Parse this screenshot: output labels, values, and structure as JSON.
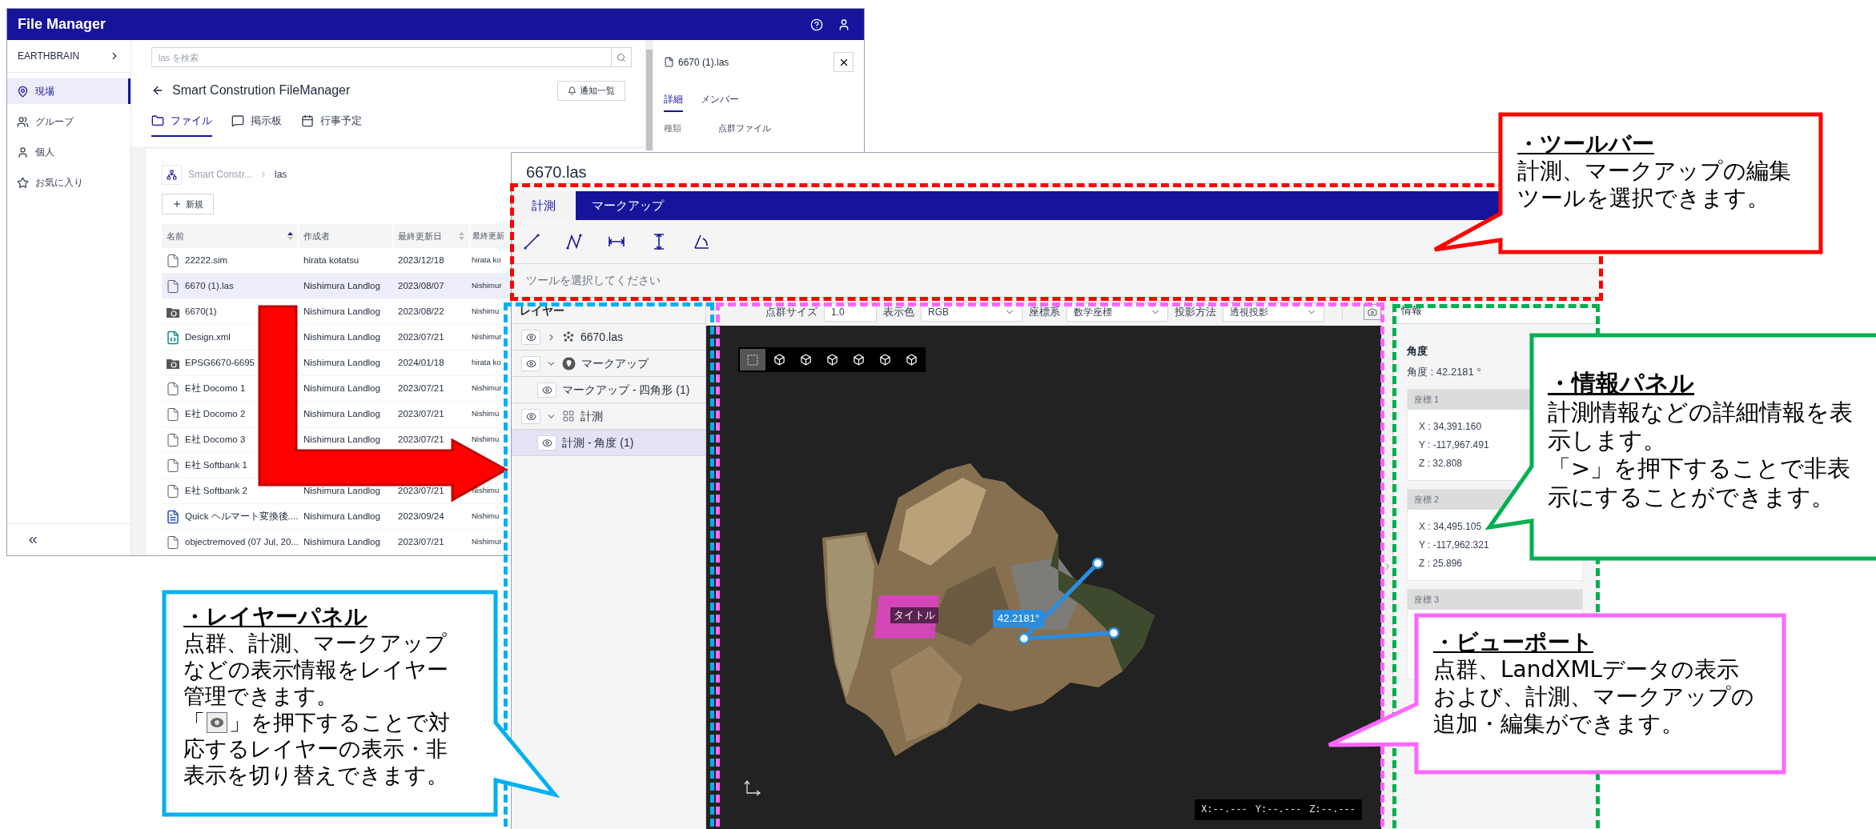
{
  "file_manager": {
    "title": "File Manager",
    "sidebar": {
      "org": "EARTHBRAIN",
      "items": [
        {
          "label": "現場",
          "kind": "site",
          "selected": true
        },
        {
          "label": "グループ",
          "kind": "group",
          "selected": false
        },
        {
          "label": "個人",
          "kind": "person",
          "selected": false
        },
        {
          "label": "お気に入り",
          "kind": "favorite",
          "selected": false
        }
      ]
    },
    "search": {
      "placeholder": "las を検索"
    },
    "page_title": "Smart Constrution FileManager",
    "notify_button": "通知一覧",
    "tabs": [
      {
        "label": "ファイル",
        "kind": "files",
        "selected": true
      },
      {
        "label": "掲示板",
        "kind": "board",
        "selected": false
      },
      {
        "label": "行事予定",
        "kind": "calendar",
        "selected": false
      }
    ],
    "breadcrumb": [
      "Smart Constr...",
      "las"
    ],
    "new_button": "新規",
    "table": {
      "columns": [
        "名前",
        "作成者",
        "最終更新日",
        "最終更新"
      ],
      "rows": [
        {
          "kind": "file",
          "selected": false,
          "cells": [
            "22222.sim",
            "hirata kotatsu",
            "2023/12/18",
            "hirata ko"
          ]
        },
        {
          "kind": "file",
          "selected": true,
          "cells": [
            "6670 (1).las",
            "Nishimura Landlog",
            "2023/08/07",
            "Nishimur"
          ]
        },
        {
          "kind": "folder",
          "selected": false,
          "cells": [
            "6670(1)",
            "Nishimura Landlog",
            "2023/08/22",
            "Nishimu"
          ]
        },
        {
          "kind": "xml",
          "selected": false,
          "cells": [
            "Design.xml",
            "Nishimura Landlog",
            "2023/07/21",
            "Nishimur"
          ]
        },
        {
          "kind": "folder",
          "selected": false,
          "cells": [
            "EPSG6670-6695",
            "Nishimura Landlog",
            "2024/01/18",
            "hirata ko"
          ]
        },
        {
          "kind": "file",
          "selected": false,
          "cells": [
            "E社 Docomo 1",
            "Nishimura Landlog",
            "2023/07/21",
            "Nishimur"
          ]
        },
        {
          "kind": "file",
          "selected": false,
          "cells": [
            "E社 Docomo 2",
            "Nishimura Landlog",
            "2023/07/21",
            "Nishimu"
          ]
        },
        {
          "kind": "file",
          "selected": false,
          "cells": [
            "E社 Docomo 3",
            "Nishimura Landlog",
            "2023/07/21",
            "Nishimu"
          ]
        },
        {
          "kind": "file",
          "selected": false,
          "cells": [
            "E社 Softbank 1"
          ]
        },
        {
          "kind": "file",
          "selected": false,
          "cells": [
            "E社 Softbank 2",
            "Nishimura Landlog",
            "2023/07/21",
            "Nishimu"
          ]
        },
        {
          "kind": "txt",
          "selected": false,
          "cells": [
            "Quick ヘルマート変換後....",
            "Nishimura Landlog",
            "2023/09/24",
            "Nishimu"
          ]
        },
        {
          "kind": "file",
          "selected": false,
          "cells": [
            "objectremoved (07 Jul, 20...",
            "Nishimura Landlog",
            "2023/07/21",
            "Nishimur"
          ]
        }
      ]
    },
    "detail_panel": {
      "title": "6670 (1).las",
      "tabs": [
        {
          "label": "詳細",
          "selected": true
        },
        {
          "label": "メンバー",
          "selected": false
        }
      ],
      "fields": [
        {
          "label": "種類",
          "value": "点群ファイル"
        }
      ]
    }
  },
  "viewer": {
    "title": "6670.las",
    "tabs": [
      {
        "label": "計測",
        "selected": true
      },
      {
        "label": "マークアップ",
        "selected": false
      }
    ],
    "tools": [
      {
        "kind": "line"
      },
      {
        "kind": "polyline"
      },
      {
        "kind": "horizontal"
      },
      {
        "kind": "vertical"
      },
      {
        "kind": "angle"
      }
    ],
    "hint": "ツールを選択してください",
    "layers": {
      "title": "レイヤー",
      "items": [
        {
          "label": "6670.las",
          "kind": "pointcloud",
          "visible": true,
          "expanded": false,
          "selected": false
        },
        {
          "label": "マークアップ",
          "kind": "markup",
          "visible": true,
          "expanded": true,
          "selected": false,
          "children": [
            {
              "label": "マークアップ - 四角形 (1)",
              "visible": true,
              "selected": false
            }
          ]
        },
        {
          "label": "計測",
          "kind": "measure",
          "visible": true,
          "expanded": true,
          "selected": false,
          "children": [
            {
              "label": "計測 - 角度 (1)",
              "visible": true,
              "selected": true
            }
          ]
        }
      ]
    },
    "viewport": {
      "controls": [
        {
          "label": "点群サイズ",
          "kind": "input",
          "value": "1.0"
        },
        {
          "label": "表示色",
          "kind": "select",
          "value": "RGB"
        },
        {
          "label": "座標系",
          "kind": "select",
          "value": "数学座標"
        },
        {
          "label": "投影方法",
          "kind": "select",
          "value": "透視投影"
        }
      ],
      "view_buttons": [
        {
          "selected": true
        },
        {
          "selected": false
        },
        {
          "selected": false
        },
        {
          "selected": false
        },
        {
          "selected": false
        },
        {
          "selected": false
        },
        {
          "selected": false
        }
      ],
      "markup_label": "タイトル",
      "angle_label": "42.2181°",
      "coordinates": [
        "X:--.---",
        "Y:--.---",
        "Z:--.---"
      ]
    },
    "info": {
      "title": "情報",
      "heading": "角度",
      "angle": "角度 : 42.2181 °",
      "points": [
        {
          "title": "座標 1",
          "lines": [
            "X : 34,391.160",
            "Y : -117,967.491",
            "Z : 32.808"
          ]
        },
        {
          "title": "座標 2",
          "lines": [
            "X : 34,495.105",
            "Y : -117,962.321",
            "Z : 25.896"
          ]
        },
        {
          "title": "座標 3"
        }
      ]
    }
  },
  "callouts": [
    {
      "kind": "toolbar",
      "color": "#ff0000",
      "title": "・ツールバー",
      "lines": [
        [
          {
            "kind": "text",
            "text": "計測、マークアップの編集"
          }
        ],
        [
          {
            "kind": "text",
            "text": "ツールを選択できます。"
          }
        ]
      ]
    },
    {
      "kind": "info",
      "color": "#00b050",
      "title": "・情報パネル",
      "lines": [
        [
          {
            "kind": "text",
            "text": "計測情報などの詳細情報を表"
          }
        ],
        [
          {
            "kind": "text",
            "text": "示します。"
          }
        ],
        [
          {
            "kind": "text",
            "text": "「>」を押下することで非表"
          }
        ],
        [
          {
            "kind": "text",
            "text": "示にすることができます。"
          }
        ]
      ]
    },
    {
      "kind": "layer",
      "color": "#00b0f0",
      "title": "・レイヤーパネル",
      "lines": [
        [
          {
            "kind": "text",
            "text": "点群、計測、マークアップ"
          }
        ],
        [
          {
            "kind": "text",
            "text": "などの表示情報をレイヤー"
          }
        ],
        [
          {
            "kind": "text",
            "text": "管理できます。"
          }
        ],
        [
          {
            "kind": "text",
            "text": "「"
          },
          {
            "kind": "eye"
          },
          {
            "kind": "text",
            "text": "」を押下することで対"
          }
        ],
        [
          {
            "kind": "text",
            "text": "応するレイヤーの表示・非"
          }
        ],
        [
          {
            "kind": "text",
            "text": "表示を切り替えできます。"
          }
        ]
      ]
    },
    {
      "kind": "viewport",
      "color": "#ff66ff",
      "title": "・ビューポート",
      "lines": [
        [
          {
            "kind": "text",
            "text": "点群、LandXMLデータの表示"
          }
        ],
        [
          {
            "kind": "text",
            "text": "および、計測、マークアップの"
          }
        ],
        [
          {
            "kind": "text",
            "text": "追加・編集ができます。"
          }
        ]
      ]
    }
  ]
}
